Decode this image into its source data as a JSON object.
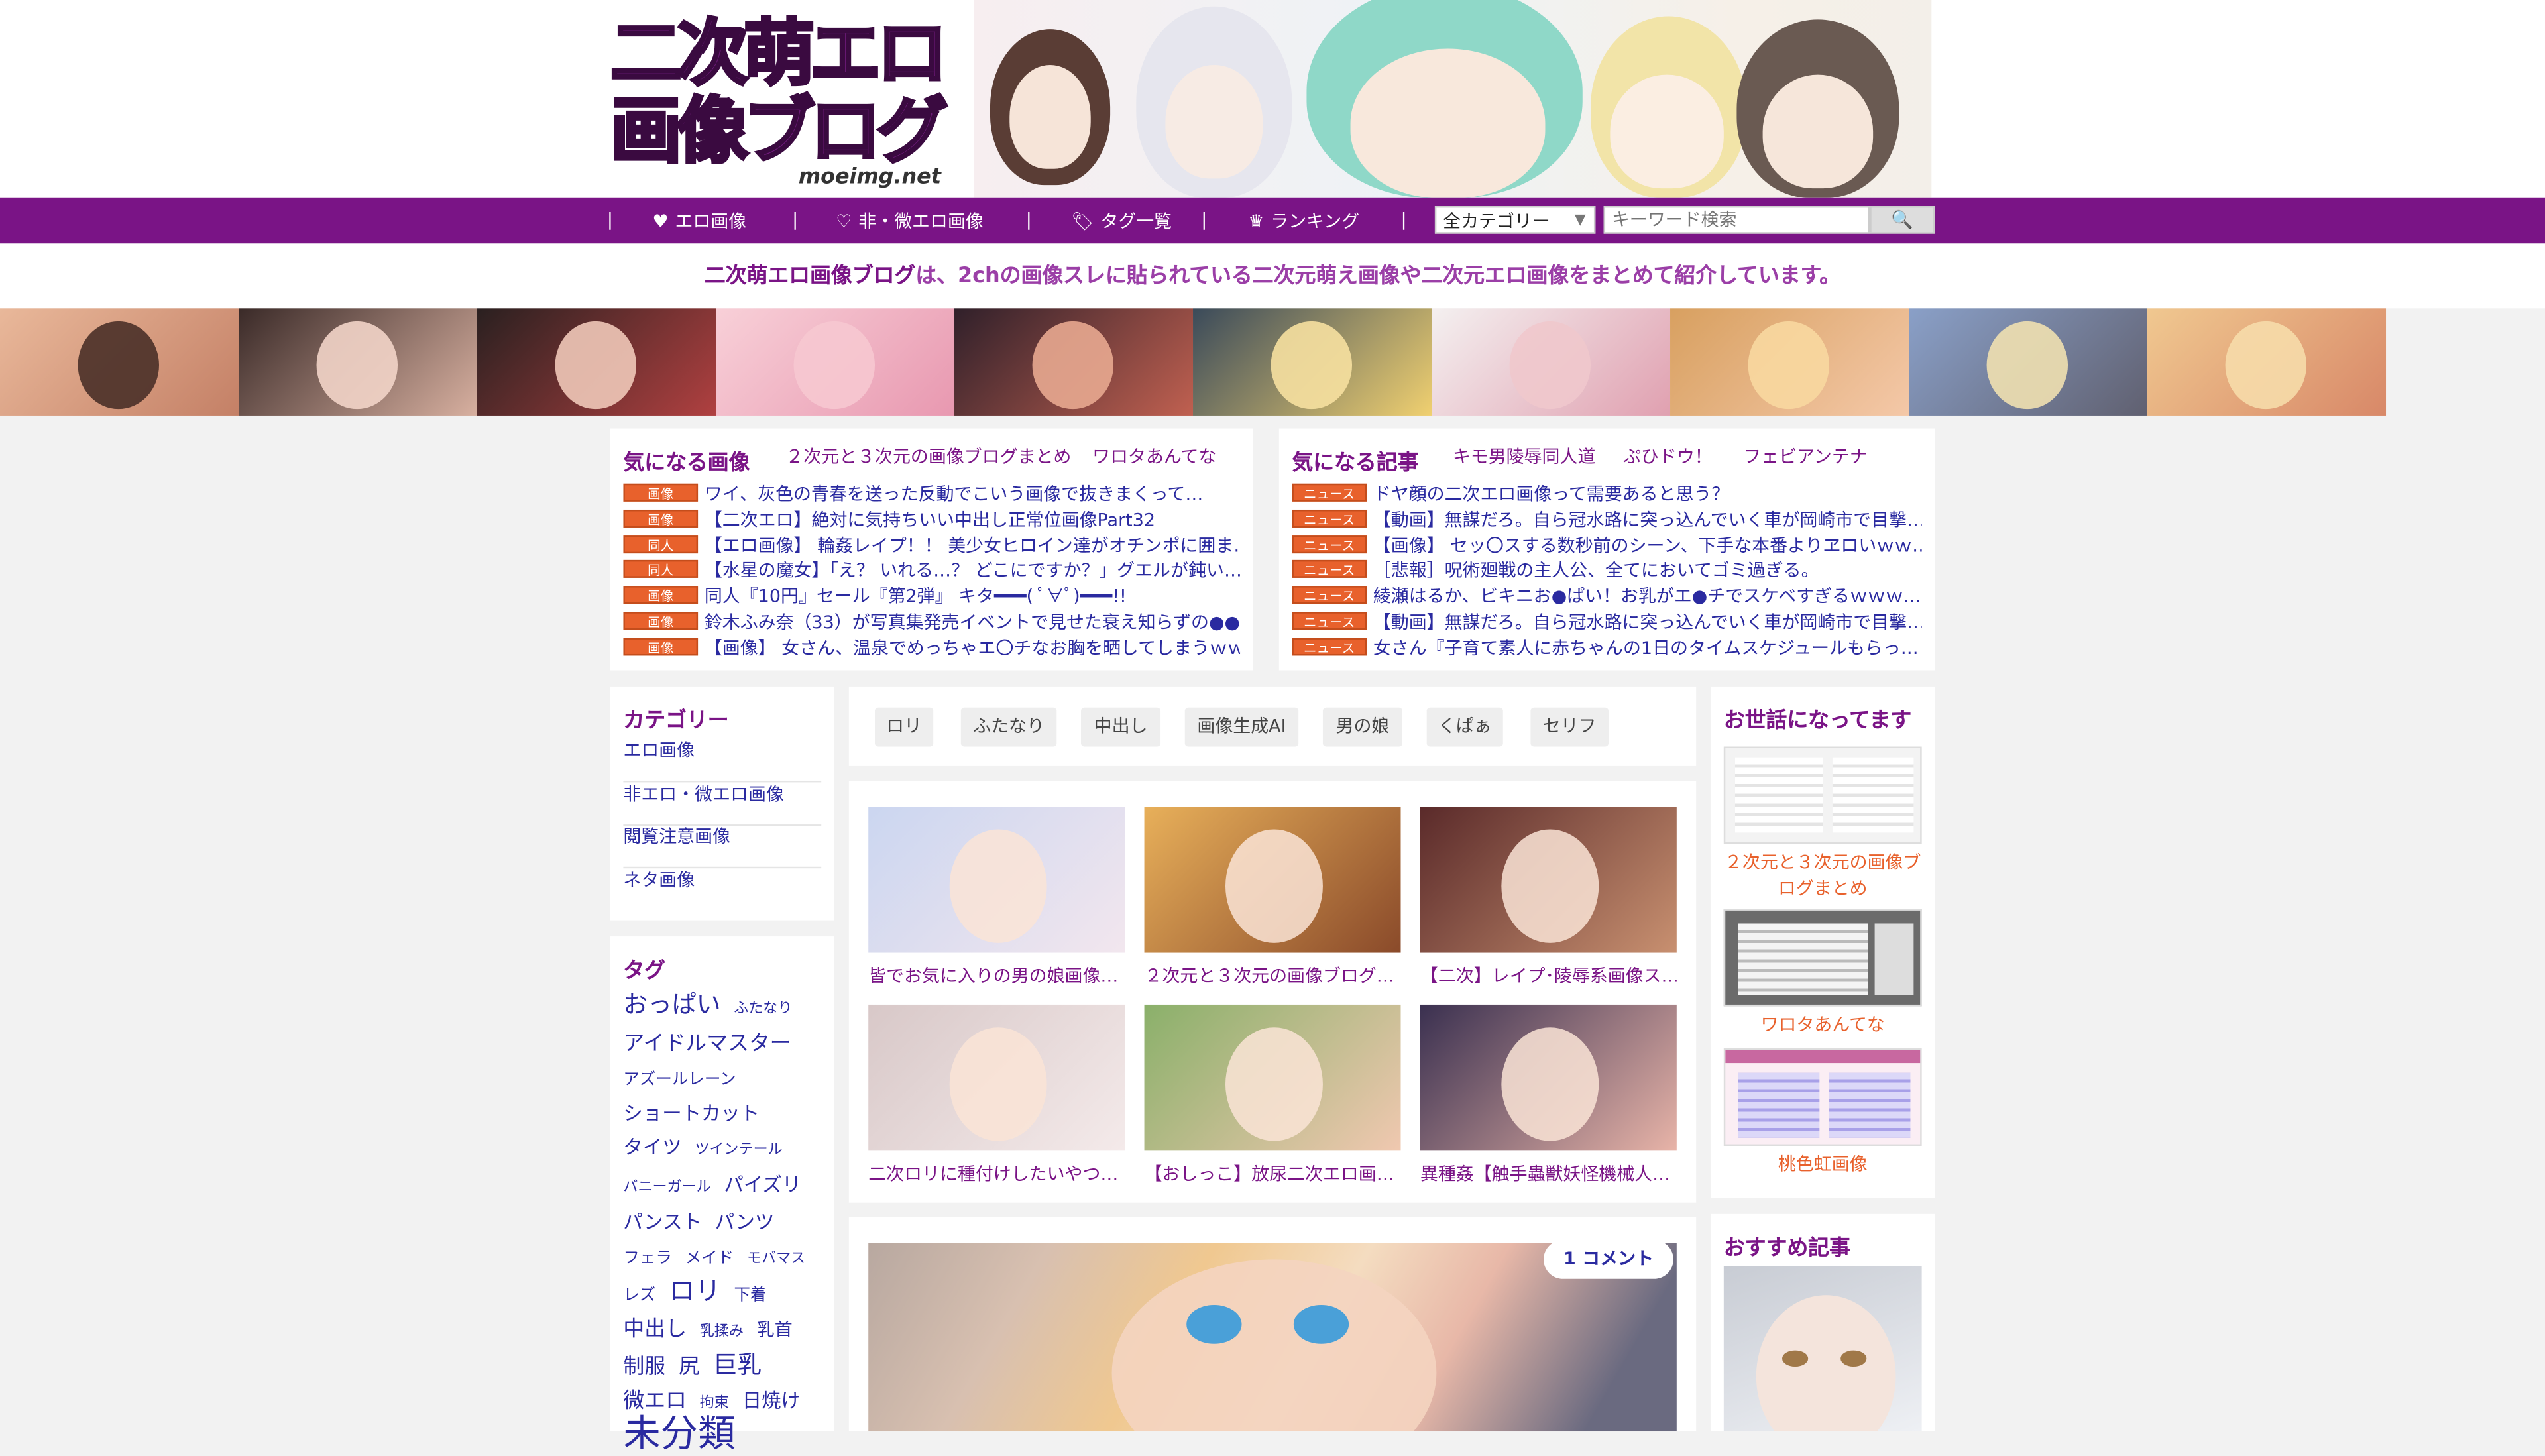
{
  "header": {
    "logo_line1": "二次萌エロ",
    "logo_line2": "画像ブログ",
    "logo_domain": "moeimg.net"
  },
  "nav": {
    "items": [
      {
        "icon": "heart-icon",
        "label": "エロ画像"
      },
      {
        "icon": "heart-outline-icon",
        "label": "非・微エロ画像"
      },
      {
        "icon": "tag-icon",
        "label": "タグ一覧"
      },
      {
        "icon": "crown-icon",
        "label": "ランキング"
      }
    ],
    "category_select": "全カテゴリー",
    "search_placeholder": "キーワード検索"
  },
  "tagline": {
    "site": "二次萌エロ画像ブログ",
    "text": "は、2chの画像スレに貼られている二次元萌え画像や二次元エロ画像をまとめて紹介しています。"
  },
  "featured_images": {
    "title": "気になる画像",
    "links": [
      "２次元と３次元の画像ブログまとめ",
      "ワロタあんてな"
    ],
    "rows": [
      {
        "badge": "画像",
        "text": "ワイ、灰色の青春を送った反動でこいう画像で抜きまくって…"
      },
      {
        "badge": "画像",
        "text": "【二次エロ】絶対に気持ちいい中出し正常位画像Part32"
      },
      {
        "badge": "同人",
        "text": "【エロ画像】 輪姦レイプ！！ 美少女ヒロイン達がオチンポに囲ま…"
      },
      {
        "badge": "同人",
        "text": "【水星の魔女】「え？ いれる…？ どこにですか？」グエルが鈍い…"
      },
      {
        "badge": "画像",
        "text": "同人『10円』セール『第2弾』 キタ━━━( ﾟ∀ﾟ)━━━!!"
      },
      {
        "badge": "画像",
        "text": "鈴木ふみ奈（33）が写真集発売イベントで見せた衰え知らずの●●…"
      },
      {
        "badge": "画像",
        "text": "【画像】 女さん、温泉でめっちゃエ〇チなお胸を晒してしまうｗｗ…"
      }
    ]
  },
  "featured_articles": {
    "title": "気になる記事",
    "links": [
      "キモ男陵辱同人道",
      "ぷひドウ！",
      "フェビアンテナ"
    ],
    "rows": [
      {
        "badge": "ニュース",
        "text": "ドヤ顔の二次エロ画像って需要あると思う？"
      },
      {
        "badge": "ニュース",
        "text": "【動画】無謀だろ。自ら冠水路に突っ込んでいく車が岡崎市で目撃…"
      },
      {
        "badge": "ニュース",
        "text": "【画像】 セッ〇スする数秒前のシーン、下手な本番よりヱロいｗｗ…"
      },
      {
        "badge": "ニュース",
        "text": "［悲報］呪術廻戦の主人公、全てにおいてゴミ過ぎる。"
      },
      {
        "badge": "ニュース",
        "text": "綾瀬はるか、ビキニお●ぱい！お乳がエ●チでスケベすぎるｗｗｗ…"
      },
      {
        "badge": "ニュース",
        "text": "【動画】無謀だろ。自ら冠水路に突っ込んでいく車が岡崎市で目撃…"
      },
      {
        "badge": "ニュース",
        "text": "女さん『子育て素人に赤ちゃんの1日のタイムスケジュールもらっ…"
      }
    ]
  },
  "categories": {
    "title": "カテゴリー",
    "items": [
      "エロ画像",
      "非エロ・微エロ画像",
      "閲覧注意画像",
      "ネタ画像"
    ]
  },
  "tags": {
    "title": "タグ",
    "items": [
      {
        "label": "おっぱい",
        "size": 15
      },
      {
        "label": "ふたなり",
        "size": 9
      },
      {
        "label": "アイドルマスター",
        "size": 13
      },
      {
        "label": "アズールレーン",
        "size": 10
      },
      {
        "label": "ショートカット",
        "size": 12
      },
      {
        "label": "タイツ",
        "size": 12
      },
      {
        "label": "ツインテール",
        "size": 9
      },
      {
        "label": "バニーガール",
        "size": 9
      },
      {
        "label": "パイズリ",
        "size": 12
      },
      {
        "label": "パンスト",
        "size": 12
      },
      {
        "label": "パンツ",
        "size": 12
      },
      {
        "label": "フェラ",
        "size": 10
      },
      {
        "label": "メイド",
        "size": 10
      },
      {
        "label": "モバマス",
        "size": 9
      },
      {
        "label": "レズ",
        "size": 10
      },
      {
        "label": "ロリ",
        "size": 16
      },
      {
        "label": "下着",
        "size": 10
      },
      {
        "label": "中出し",
        "size": 13
      },
      {
        "label": "乳揉み",
        "size": 9
      },
      {
        "label": "乳首",
        "size": 11
      },
      {
        "label": "制服",
        "size": 13
      },
      {
        "label": "尻",
        "size": 13
      },
      {
        "label": "巨乳",
        "size": 15
      },
      {
        "label": "微エロ",
        "size": 13
      },
      {
        "label": "拘束",
        "size": 9
      },
      {
        "label": "日焼け",
        "size": 12
      },
      {
        "label": "未分類",
        "size": 23
      }
    ]
  },
  "chips": [
    "ロリ",
    "ふたなり",
    "中出し",
    "画像生成AI",
    "男の娘",
    "くぱぁ",
    "セリフ"
  ],
  "grid": [
    {
      "caption": "皆でお気に入りの男の娘画像…",
      "c1": "#cbd6f0",
      "c2": "#f2e6ee"
    },
    {
      "caption": "２次元と３次元の画像ブログ…",
      "c1": "#e8b05a",
      "c2": "#8a4a2a"
    },
    {
      "caption": "【二次】レイプ･陵辱系画像ス…",
      "c1": "#5a2a2a",
      "c2": "#c89070"
    },
    {
      "caption": "二次ロリに種付けしたいやつ…",
      "c1": "#d8c8c8",
      "c2": "#f4eaea"
    },
    {
      "caption": "【おしっこ】放尿二次エロ画…",
      "c1": "#8ab06a",
      "c2": "#f0c8b0"
    },
    {
      "caption": "異種姦【触手蟲獣妖怪機械人…",
      "c1": "#3a3050",
      "c2": "#e8b4a8"
    }
  ],
  "big_article": {
    "comment_count": "1",
    "comment_label": "コメント"
  },
  "right": {
    "title": "お世話になってます",
    "sites": [
      "２次元と３次元の画像ブログまとめ",
      "ワロタあんてな",
      "桃色虹画像"
    ],
    "recommend_title": "おすすめ記事"
  },
  "colors": {
    "brand_purple": "#7a1486",
    "badge_orange": "#e8612c",
    "link_blue": "#2a2aa0"
  }
}
